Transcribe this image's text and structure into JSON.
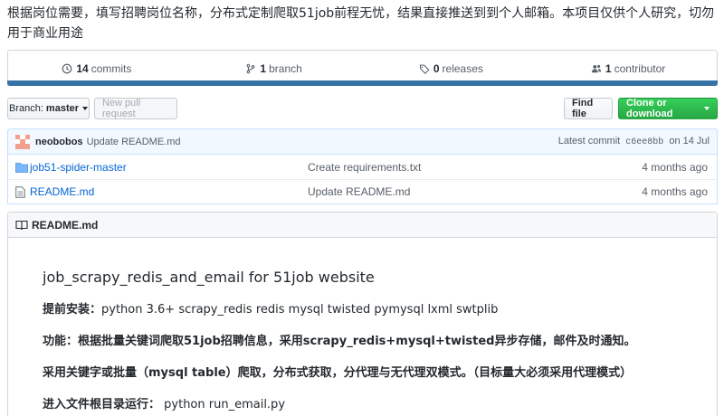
{
  "description": "根据岗位需要，填写招聘岗位名称，分布式定制爬取51job前程无忧，结果直接推送到到个人邮箱。本项目仅供个人研究，切勿用于商业用途",
  "stats": {
    "commits_count": "14",
    "commits_label": "commits",
    "branches_count": "1",
    "branches_label": "branch",
    "releases_count": "0",
    "releases_label": "releases",
    "contributors_count": "1",
    "contributors_label": "contributor"
  },
  "language_color": "#3572A5",
  "toolbar": {
    "branch_prefix": "Branch:",
    "branch_name": "master",
    "new_pr_label": "New pull request",
    "find_file_label": "Find file",
    "clone_label": "Clone or download"
  },
  "latest_commit": {
    "author": "neobobos",
    "message": "Update README.md",
    "prefix": "Latest commit",
    "sha": "c6ee8bb",
    "date": "on 14 Jul"
  },
  "files": [
    {
      "type": "folder",
      "name": "job51-spider-master",
      "message": "Create requirements.txt",
      "age": "4 months ago"
    },
    {
      "type": "file",
      "name": "README.md",
      "message": "Update README.md",
      "age": "4 months ago"
    }
  ],
  "readme": {
    "header": "README.md",
    "title": "job_scrapy_redis_and_email for 51job website",
    "lines": [
      {
        "label": "提前安装：",
        "text": "python 3.6+ scrapy_redis redis mysql twisted pymysql lxml swtplib"
      },
      {
        "label": "功能：根据批量关键词爬取51job招聘信息，采用scrapy_redis+mysql+twisted异步存储，邮件及时通知。",
        "text": ""
      },
      {
        "label": "采用关键字或批量（mysql table）爬取，分布式获取，分代理与无代理双模式。（目标量大必须采用代理模式）",
        "text": ""
      },
      {
        "label": "进入文件根目录运行：",
        "text": " python run_email.py"
      }
    ]
  }
}
